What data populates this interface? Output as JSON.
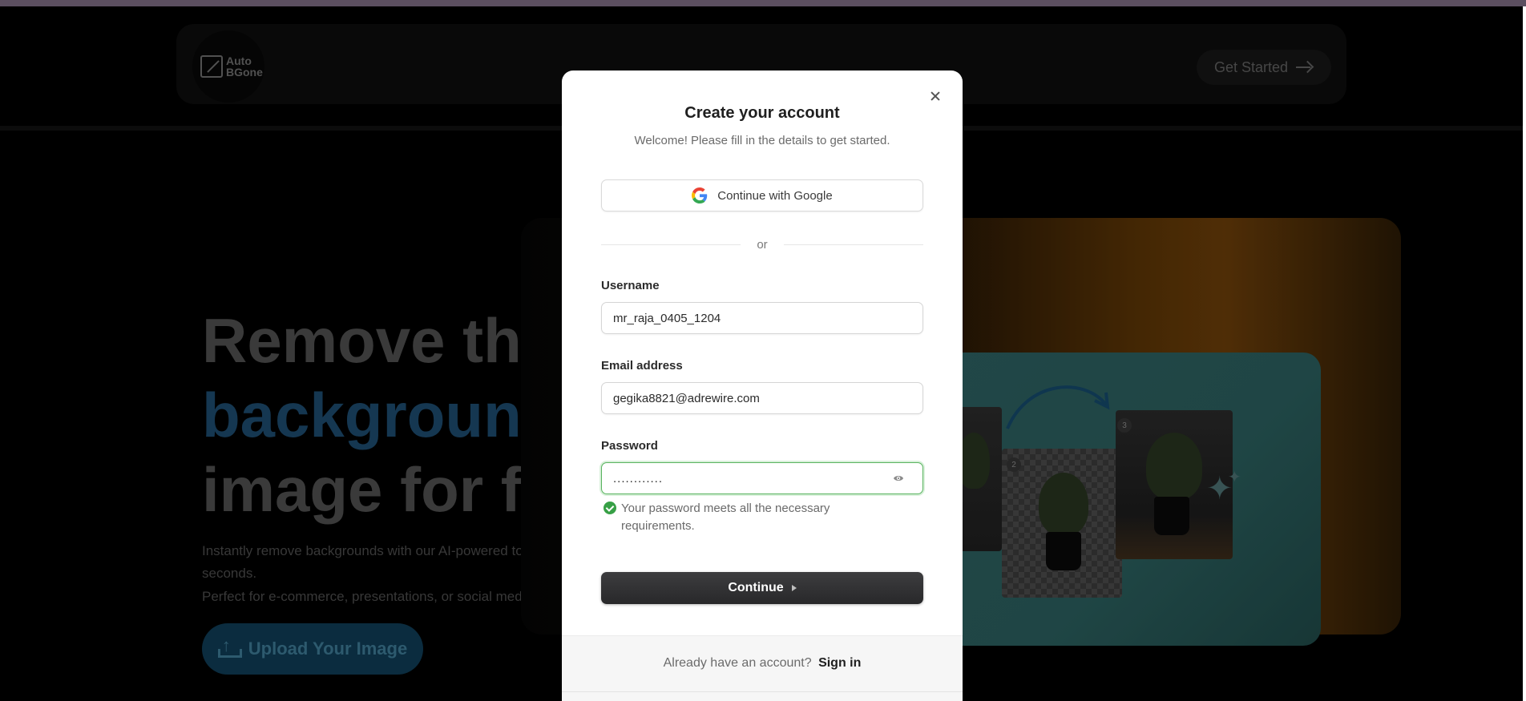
{
  "background": {
    "logo": {
      "line1": "Auto",
      "line2": "BGone"
    },
    "nav": {
      "get_started_label": "Get Started"
    },
    "hero": {
      "line1": "Remove the",
      "line2": "background",
      "line3": "image for fre",
      "sub1": "Instantly remove backgrounds with our AI-powered tool fo",
      "sub2": "seconds.",
      "sub3": "Perfect for e-commerce, presentations, or social media—fa",
      "upload_label": "Upload Your Image"
    },
    "illustration": {
      "badge2": "2",
      "badge3": "3"
    }
  },
  "modal": {
    "title": "Create your account",
    "subtitle": "Welcome! Please fill in the details to get started.",
    "google_label": "Continue with Google",
    "divider": "or",
    "username": {
      "label": "Username",
      "value": "mr_raja_0405_1204"
    },
    "email": {
      "label": "Email address",
      "value": "gegika8821@adrewire.com"
    },
    "password": {
      "label": "Password",
      "value": "............",
      "status": "Your password meets all the necessary requirements."
    },
    "continue_label": "Continue",
    "footer": {
      "prompt": "Already have an account?",
      "signin": "Sign in"
    }
  },
  "colors": {
    "accent_dark": "#2b2b2d",
    "success": "#37a046",
    "hero_blue": "#1d4a6d"
  }
}
